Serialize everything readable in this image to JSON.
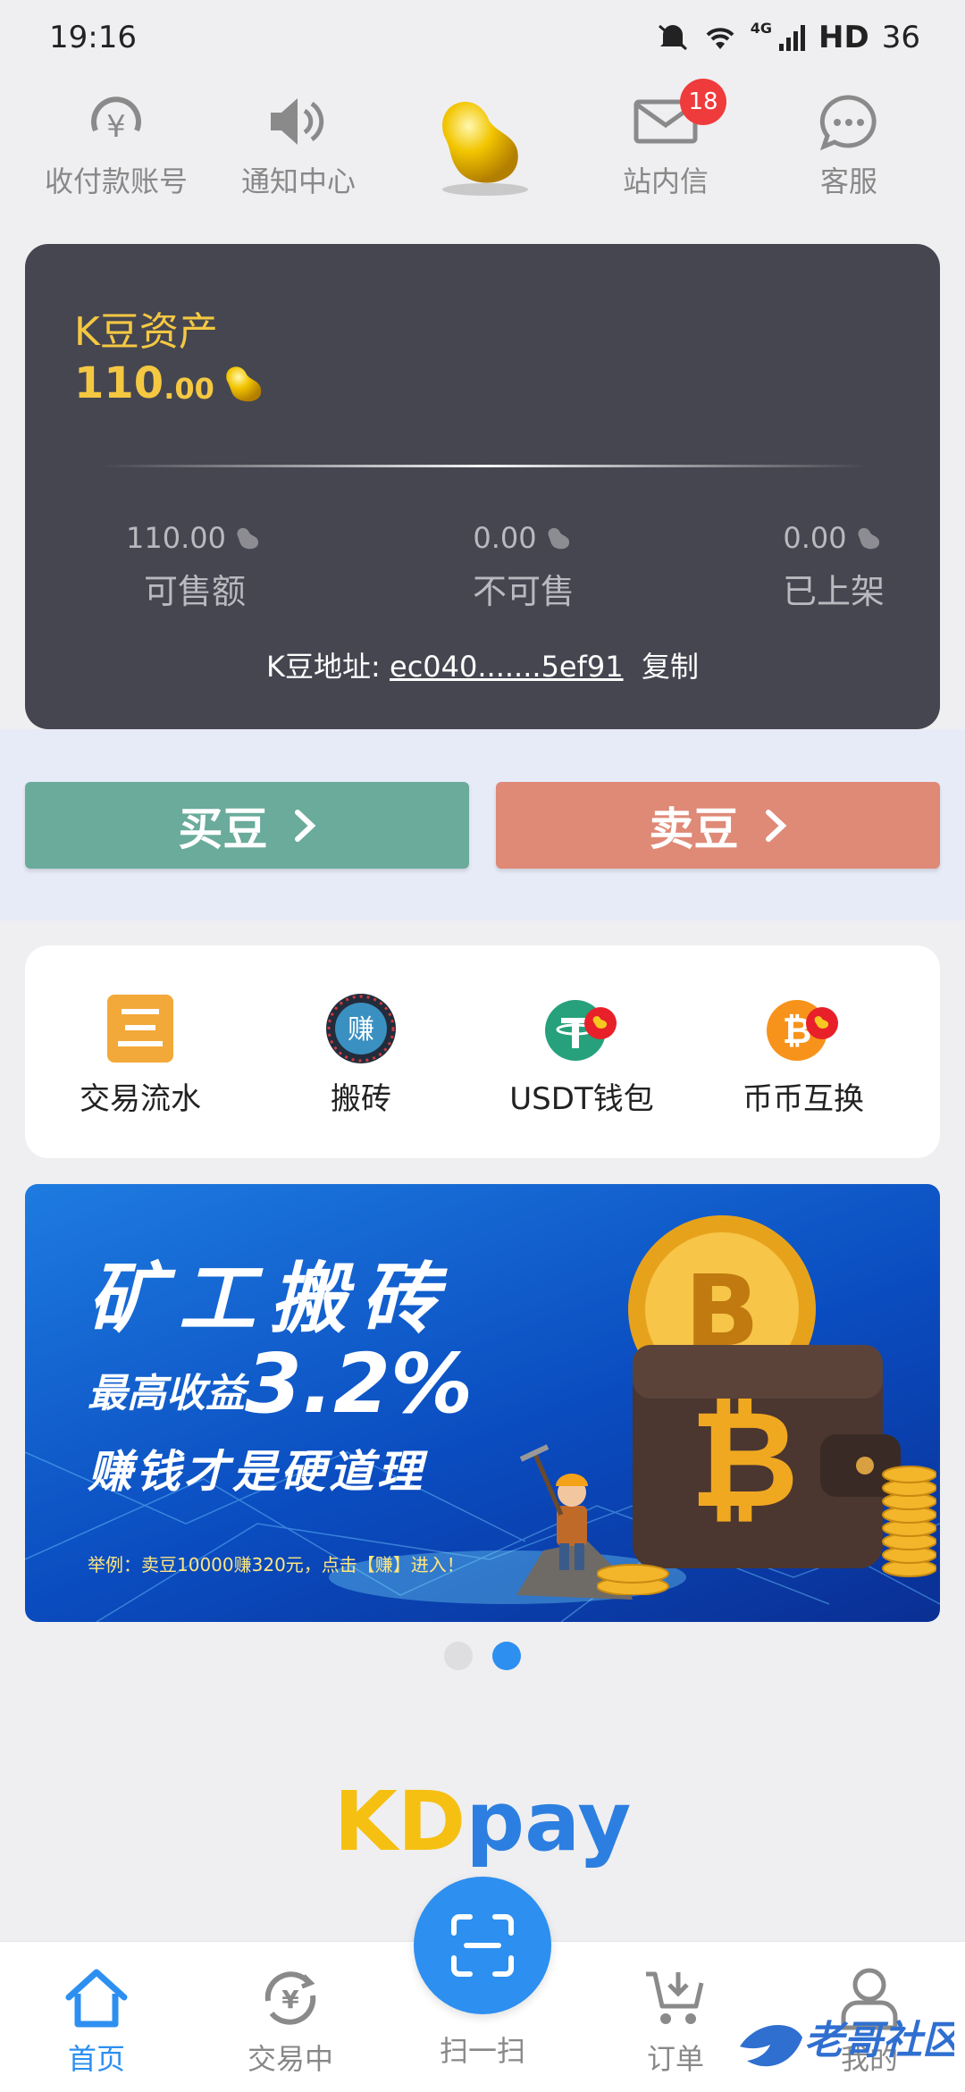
{
  "status_bar": {
    "time": "19:16",
    "network": "4G",
    "hd": "HD",
    "battery": "36"
  },
  "top_nav": {
    "items": [
      {
        "label": "收付款账号",
        "icon": "yen-circle-icon"
      },
      {
        "label": "通知中心",
        "icon": "speaker-icon"
      },
      {
        "label": "",
        "icon": "gold-bean-icon"
      },
      {
        "label": "站内信",
        "icon": "mail-icon",
        "badge": "18"
      },
      {
        "label": "客服",
        "icon": "chat-bubble-icon"
      }
    ]
  },
  "asset_card": {
    "title": "K豆资产",
    "amount_int": "110",
    "amount_dec": ".00",
    "stats": [
      {
        "value": "110.00",
        "label": "可售额"
      },
      {
        "value": "0.00",
        "label": "不可售"
      },
      {
        "value": "0.00",
        "label": "已上架"
      }
    ],
    "address_label": "K豆地址: ",
    "address_value": "ec040.......5ef91",
    "copy_label": "复制"
  },
  "actions": {
    "buy_label": "买豆",
    "sell_label": "卖豆"
  },
  "services": [
    {
      "label": "交易流水",
      "icon": "ledger-icon"
    },
    {
      "label": "搬砖",
      "icon": "earn-icon",
      "icon_text": "赚"
    },
    {
      "label": "USDT钱包",
      "icon": "tether-icon"
    },
    {
      "label": "币币互换",
      "icon": "bitcoin-swap-icon"
    }
  ],
  "banner": {
    "headline": "矿工搬砖",
    "subline_prefix": "最高收益",
    "subline_rate": "3.2%",
    "tagline": "赚钱才是硬道理",
    "note": "举例：卖豆10000赚320元，点击【赚】进入！",
    "page_index": 2,
    "page_count": 2
  },
  "brand": {
    "kd": "KD",
    "pay": "pay"
  },
  "tab_bar": {
    "tabs": [
      {
        "label": "首页",
        "icon": "home-icon",
        "active": true
      },
      {
        "label": "交易中",
        "icon": "yen-refresh-icon",
        "active": false
      },
      {
        "label": "扫一扫",
        "icon": "scan-icon",
        "active": false
      },
      {
        "label": "订单",
        "icon": "cart-icon",
        "active": false
      },
      {
        "label": "我的",
        "icon": "user-icon",
        "active": false
      }
    ]
  },
  "watermark": {
    "text": "老哥社区"
  },
  "colors": {
    "accent": "#2d8ff0",
    "gold": "#f5c842",
    "buy": "#6aab9b",
    "sell": "#df8977",
    "card": "#454650"
  }
}
